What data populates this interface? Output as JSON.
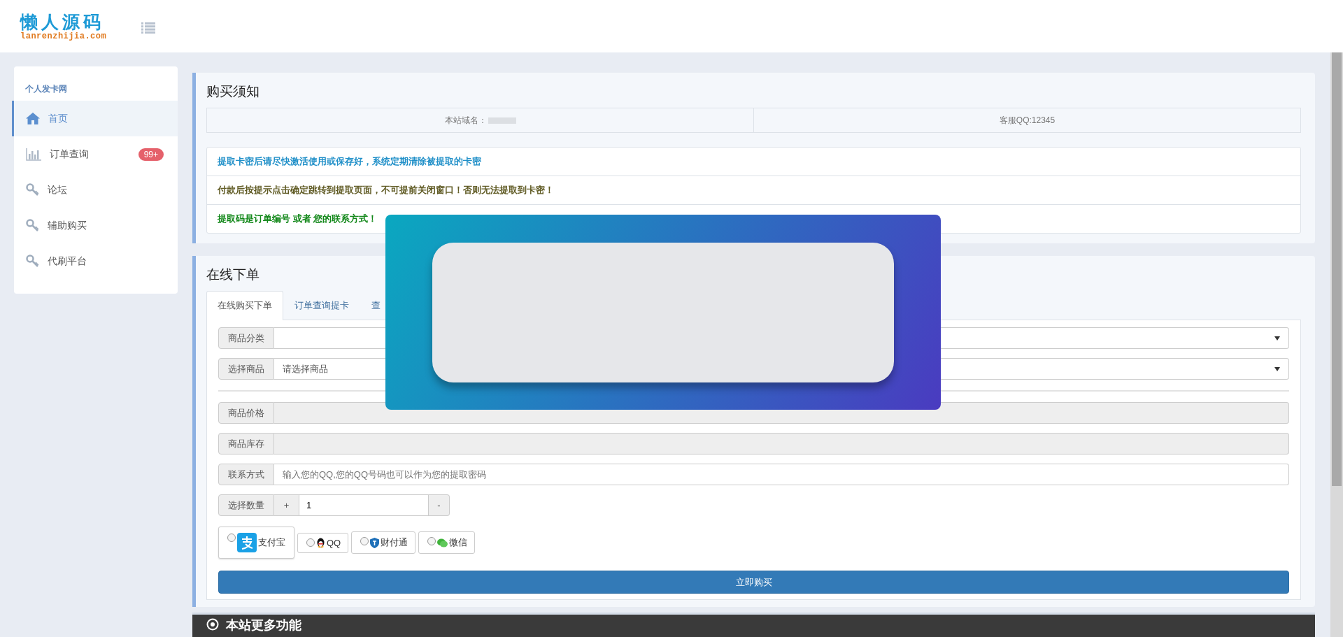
{
  "header": {
    "logo_title": "懒人源码",
    "logo_subtitle": "lanrenzhijia.com"
  },
  "sidebar": {
    "heading": "个人发卡网",
    "items": [
      {
        "label": "首页",
        "kind": "home",
        "selected": true
      },
      {
        "label": "订单查询",
        "kind": "chart",
        "selected": false,
        "badge": "99+"
      },
      {
        "label": "论坛",
        "kind": "key",
        "selected": false
      },
      {
        "label": "辅助购买",
        "kind": "key",
        "selected": false
      },
      {
        "label": "代刷平台",
        "kind": "key",
        "selected": false
      }
    ]
  },
  "notice": {
    "title": "购买须知",
    "info": [
      {
        "label": "本站域名：",
        "blurred": true
      },
      {
        "label": "客服QQ:12345",
        "blurred": false
      }
    ],
    "messages": [
      {
        "text": "提取卡密后请尽快激活使用或保存好，系统定期清除被提取的卡密",
        "color": "#1f8fc8"
      },
      {
        "text": "付款后按提示点击确定跳转到提取页面，不可提前关闭窗口！否则无法提取到卡密！",
        "color": "#5f5a23"
      },
      {
        "text": "提取码是订单编号 或者 您的联系方式！",
        "color": "#13881a"
      }
    ]
  },
  "order": {
    "title": "在线下单",
    "tabs": [
      {
        "label": "在线购买下单",
        "selected": true
      },
      {
        "label": "订单查询提卡",
        "selected": false
      },
      {
        "label": "查",
        "selected": false
      }
    ],
    "fields": [
      {
        "kind": "select",
        "label": "商品分类"
      },
      {
        "kind": "select",
        "label": "选择商品",
        "value": "请选择商品"
      },
      {
        "kind": "divider"
      },
      {
        "kind": "readonly",
        "label": "商品价格"
      },
      {
        "kind": "readonly",
        "label": "商品库存"
      },
      {
        "kind": "text",
        "label": "联系方式",
        "placeholder": "输入您的QQ,您的QQ号码也可以作为您的提取密码"
      },
      {
        "kind": "quantity",
        "label": "选择数量",
        "plus": "+",
        "value": "1",
        "minus": "-"
      }
    ],
    "payments": [
      {
        "label": "支付宝",
        "kind": "alipay",
        "selected": true,
        "checked": false
      },
      {
        "label": "QQ",
        "kind": "qq",
        "selected": false,
        "checked": false
      },
      {
        "label": "财付通",
        "kind": "tenpay",
        "selected": false,
        "checked": false
      },
      {
        "label": "微信",
        "kind": "wechat",
        "selected": false,
        "checked": false
      }
    ],
    "submit": "立即购买"
  },
  "more": {
    "title": "本站更多功能"
  }
}
